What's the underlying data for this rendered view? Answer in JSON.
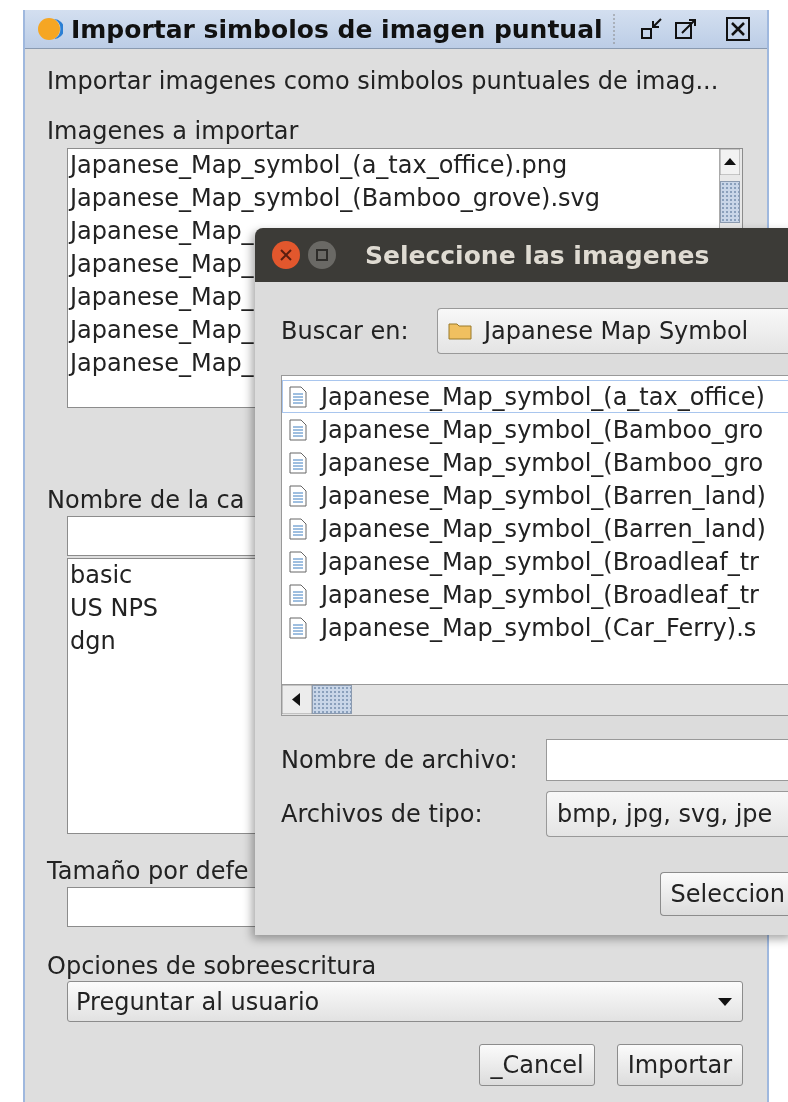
{
  "window": {
    "title": "Importar simbolos de imagen puntual"
  },
  "description": "Importar imagenes como simbolos puntuales de imag...",
  "images_label": "Imagenes a importar",
  "images": [
    "Japanese_Map_symbol_(a_tax_office).png",
    "Japanese_Map_symbol_(Bamboo_grove).svg",
    "Japanese_Map_",
    "Japanese_Map_",
    "Japanese_Map_",
    "Japanese_Map_",
    "Japanese_Map_"
  ],
  "category_label": "Nombre de la ca",
  "categories": [
    "basic",
    "US NPS",
    "dgn"
  ],
  "size_label": "Tamaño por defe",
  "overwrite_label": "Opciones de sobreescritura",
  "overwrite_value": "Preguntar al usuario",
  "buttons": [
    "_Cancel",
    "Importar"
  ],
  "file_dialog": {
    "title": "Seleccione las imagenes",
    "look_in_label": "Buscar en:",
    "look_in_value": "Japanese Map Symbol",
    "files": [
      {
        "name": "Japanese_Map_symbol_(a_tax_office)",
        "selected": true
      },
      {
        "name": "Japanese_Map_symbol_(Bamboo_gro",
        "selected": false
      },
      {
        "name": "Japanese_Map_symbol_(Bamboo_gro",
        "selected": false
      },
      {
        "name": "Japanese_Map_symbol_(Barren_land)",
        "selected": false
      },
      {
        "name": "Japanese_Map_symbol_(Barren_land)",
        "selected": false
      },
      {
        "name": "Japanese_Map_symbol_(Broadleaf_tr",
        "selected": false
      },
      {
        "name": "Japanese_Map_symbol_(Broadleaf_tr",
        "selected": false
      },
      {
        "name": "Japanese_Map_symbol_(Car_Ferry).s",
        "selected": false
      }
    ],
    "file_name_label": "Nombre de archivo:",
    "file_type_label": "Archivos de tipo:",
    "file_type_value": "bmp, jpg, svg, jpe",
    "buttons": [
      "Seleccion"
    ]
  }
}
